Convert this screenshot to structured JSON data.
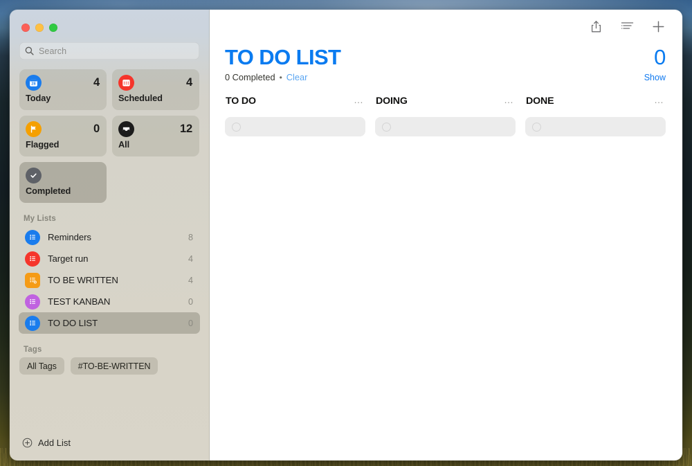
{
  "window": {
    "traffic_lights": [
      "close",
      "minimize",
      "zoom"
    ]
  },
  "sidebar": {
    "search": {
      "placeholder": "Search",
      "value": ""
    },
    "smart_lists": [
      {
        "id": "today",
        "label": "Today",
        "count": "4",
        "icon": "calendar-day-icon",
        "color": "#1a7ced",
        "selected": false
      },
      {
        "id": "scheduled",
        "label": "Scheduled",
        "count": "4",
        "icon": "calendar-icon",
        "color": "#f5352b",
        "selected": false
      },
      {
        "id": "flagged",
        "label": "Flagged",
        "count": "0",
        "icon": "flag-icon",
        "color": "#f5a001",
        "selected": false
      },
      {
        "id": "all",
        "label": "All",
        "count": "12",
        "icon": "inbox-icon",
        "color": "#1c1c1c",
        "selected": false
      },
      {
        "id": "completed",
        "label": "Completed",
        "count": "",
        "icon": "checkmark-icon",
        "color": "#5e6167",
        "selected": true
      }
    ],
    "my_lists_heading": "My Lists",
    "my_lists": [
      {
        "label": "Reminders",
        "count": "8",
        "color": "#1a7ced",
        "shape": "circle",
        "selected": false
      },
      {
        "label": "Target run",
        "count": "4",
        "color": "#f5352b",
        "shape": "circle",
        "selected": false
      },
      {
        "label": "TO BE WRITTEN",
        "count": "4",
        "color": "#f59b16",
        "shape": "square",
        "selected": false
      },
      {
        "label": "TEST KANBAN",
        "count": "0",
        "color": "#c062e0",
        "shape": "circle",
        "selected": false
      },
      {
        "label": "TO DO LIST",
        "count": "0",
        "color": "#1a7ced",
        "shape": "circle",
        "selected": true
      }
    ],
    "tags_heading": "Tags",
    "tags": [
      {
        "label": "All Tags"
      },
      {
        "label": "#TO-BE-WRITTEN"
      }
    ],
    "add_list_label": "Add List"
  },
  "toolbar": {
    "share_label": "Share",
    "view_label": "List View Options",
    "add_label": "Add Reminder"
  },
  "main": {
    "title": "TO DO LIST",
    "total_count": "0",
    "completed_text": "0 Completed",
    "separator": "•",
    "clear_label": "Clear",
    "show_label": "Show",
    "accent_color": "#0a7bf0",
    "columns": [
      {
        "title": "TO DO",
        "more": "…",
        "placeholder": ""
      },
      {
        "title": "DOING",
        "more": "…",
        "placeholder": ""
      },
      {
        "title": "DONE",
        "more": "…",
        "placeholder": ""
      }
    ]
  }
}
